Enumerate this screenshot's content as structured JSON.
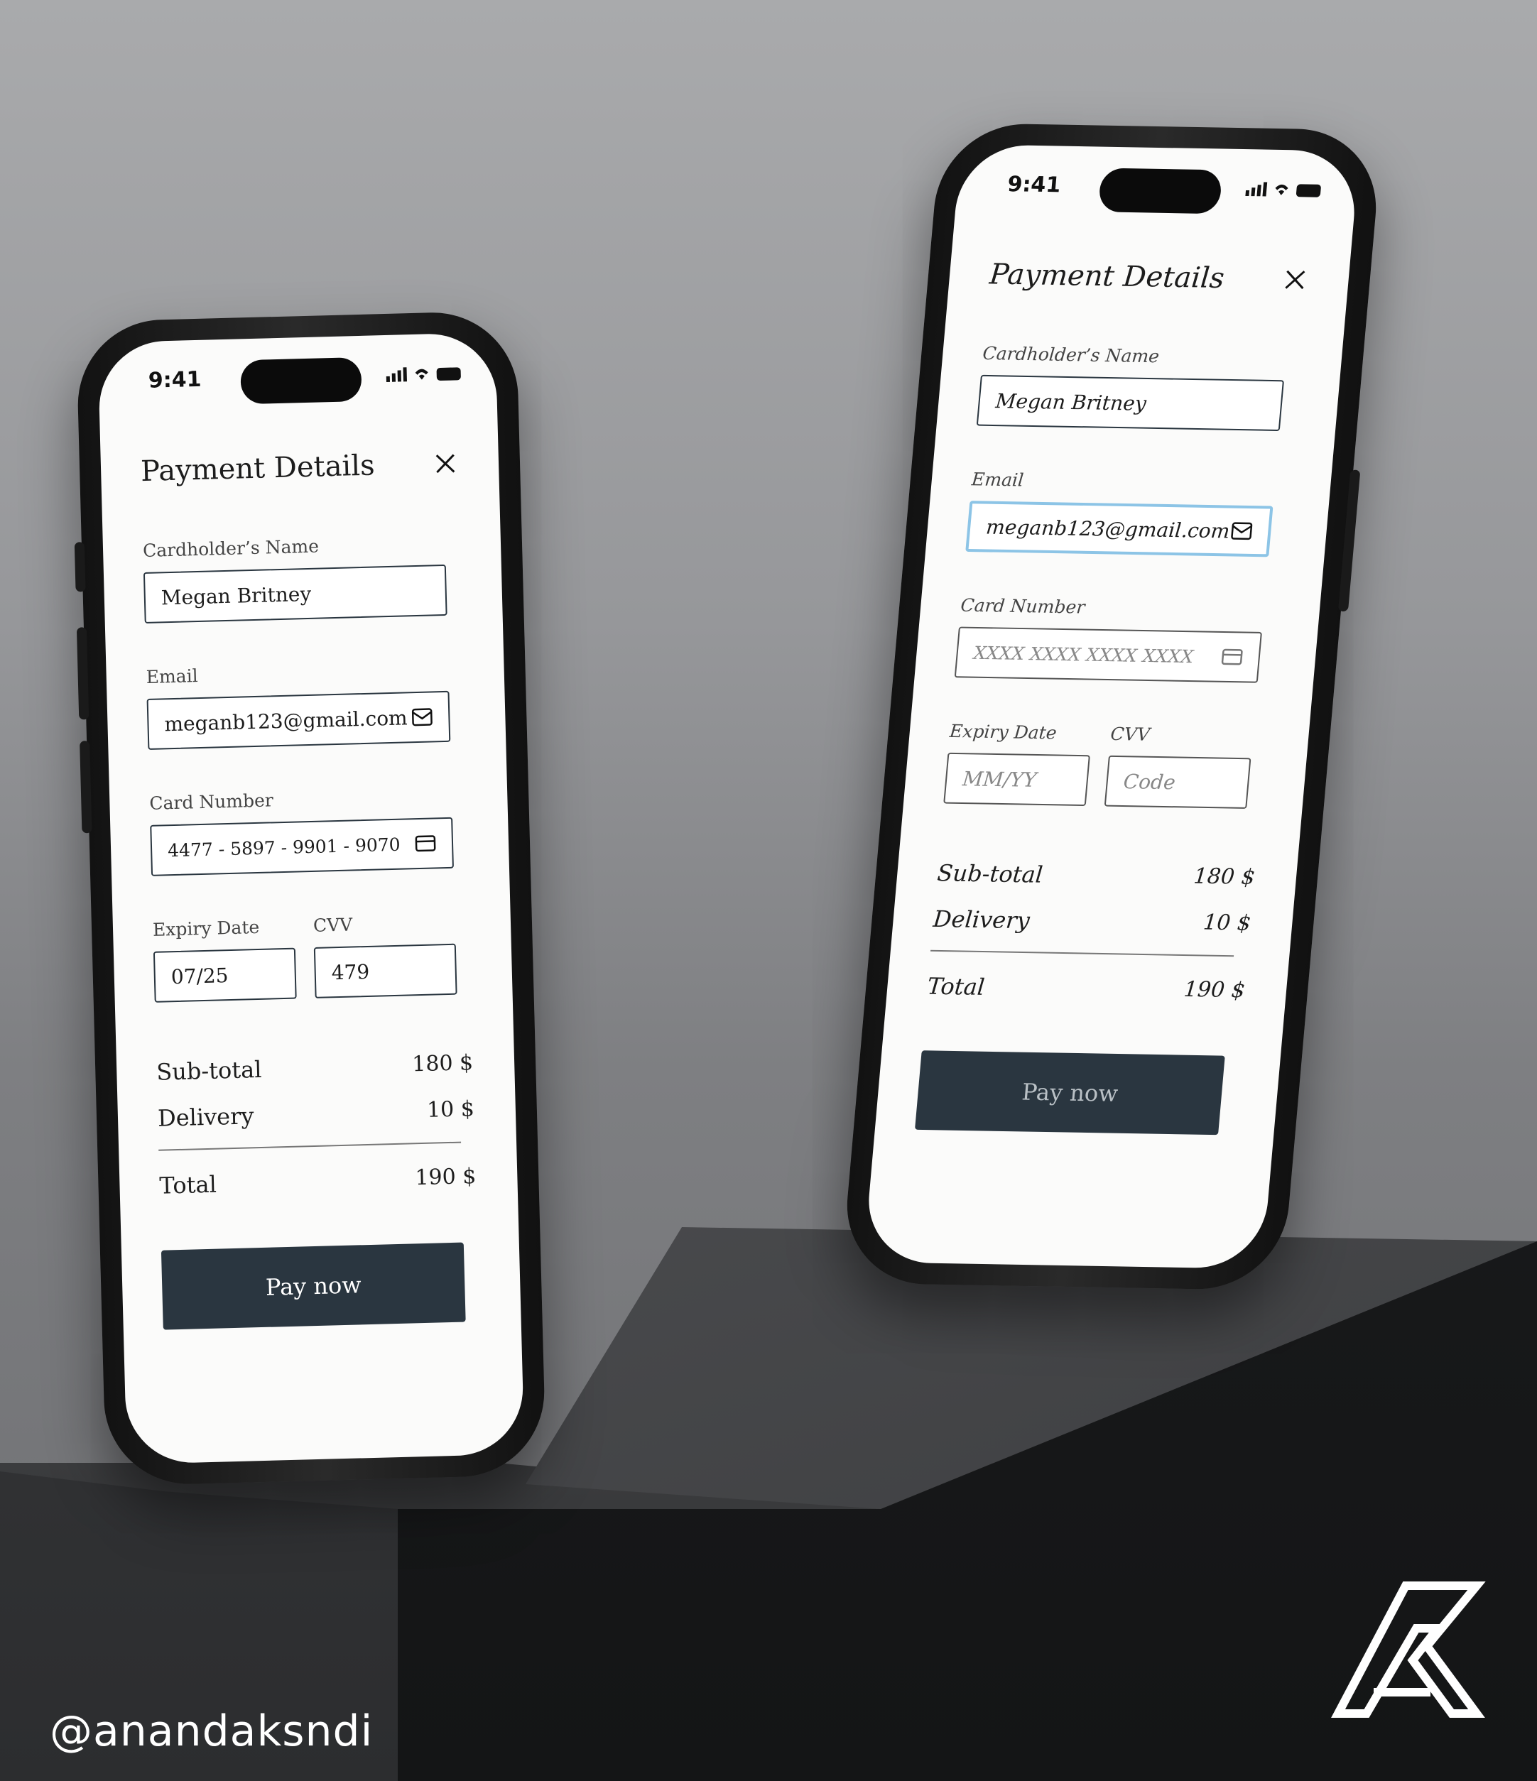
{
  "status": {
    "time": "9:41"
  },
  "left_phone": {
    "title": "Payment Details",
    "fields": {
      "name_label": "Cardholder’s Name",
      "name_value": "Megan Britney",
      "email_label": "Email",
      "email_value": "meganb123@gmail.com",
      "card_label": "Card Number",
      "card_value": "4477 - 5897 - 9901 - 9070",
      "expiry_label": "Expiry Date",
      "expiry_value": "07/25",
      "cvv_label": "CVV",
      "cvv_value": "479"
    },
    "summary": {
      "subtotal_label": "Sub-total",
      "subtotal_value": "180 $",
      "delivery_label": "Delivery",
      "delivery_value": "10 $",
      "total_label": "Total",
      "total_value": "190 $"
    },
    "pay_label": "Pay now"
  },
  "right_phone": {
    "title": "Payment Details",
    "fields": {
      "name_label": "Cardholder’s Name",
      "name_value": "Megan Britney",
      "email_label": "Email",
      "email_value": "meganb123@gmail.com",
      "card_label": "Card Number",
      "card_placeholder": "XXXX XXXX XXXX XXXX",
      "expiry_label": "Expiry Date",
      "expiry_placeholder": "MM/YY",
      "cvv_label": "CVV",
      "cvv_placeholder": "Code"
    },
    "summary": {
      "subtotal_label": "Sub-total",
      "subtotal_value": "180 $",
      "delivery_label": "Delivery",
      "delivery_value": "10 $",
      "total_label": "Total",
      "total_value": "190 $"
    },
    "pay_label": "Pay now"
  },
  "watermark": {
    "handle": "@anandaksndi",
    "logo": "AK-logo"
  },
  "colors": {
    "button": "#2a3640",
    "focus_border": "#8cc4e6",
    "screen": "#fbfbfa"
  }
}
